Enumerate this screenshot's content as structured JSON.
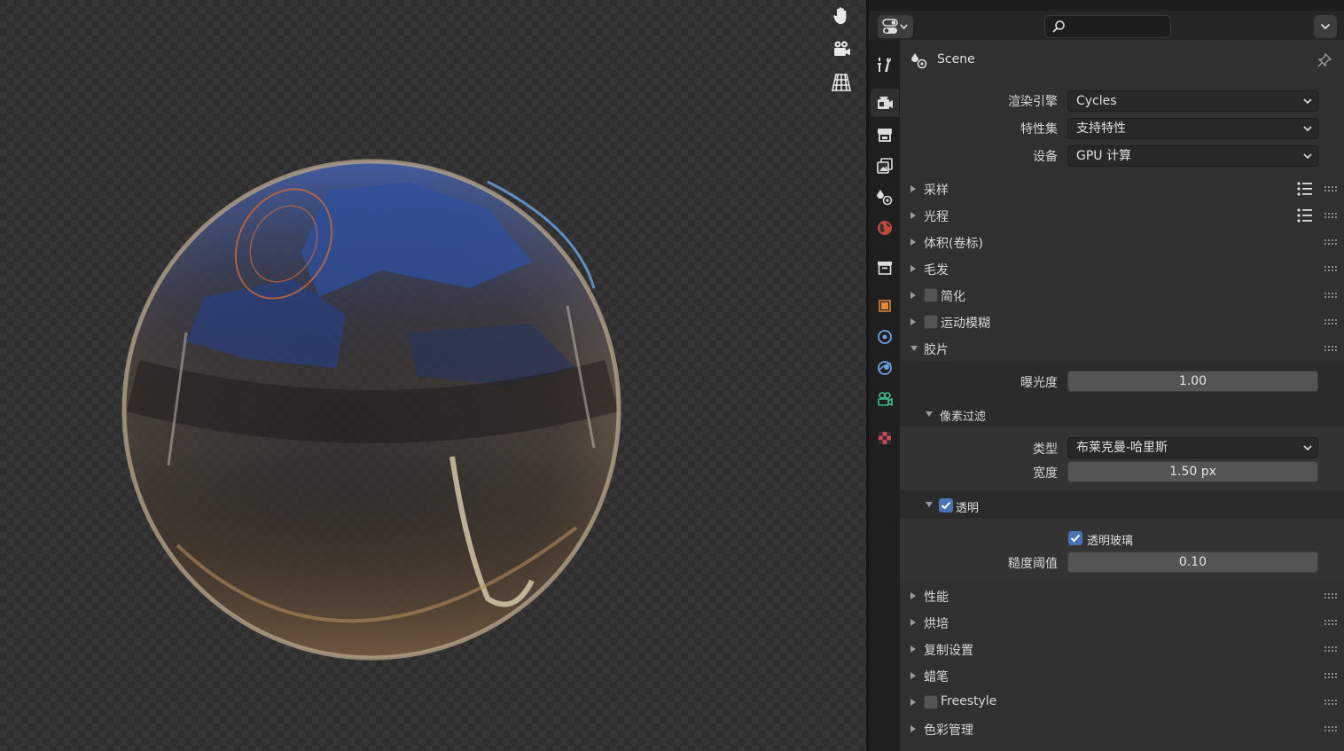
{
  "properties": {
    "context": {
      "title": "Scene"
    },
    "search": {
      "value": "",
      "placeholder": ""
    },
    "render": {
      "engine": {
        "label": "渲染引擎",
        "value": "Cycles"
      },
      "feature_set": {
        "label": "特性集",
        "value": "支持特性"
      },
      "device": {
        "label": "设备",
        "value": "GPU 计算"
      }
    },
    "panels": {
      "sampling": "采样",
      "light_paths": "光程",
      "volumes": "体积(卷标)",
      "hair": "毛发",
      "simplify": "简化",
      "motion_blur": "运动模糊",
      "film": "胶片",
      "performance": "性能",
      "bake": "烘培",
      "copy_settings": "复制设置",
      "grease_pencil": "蜡笔",
      "freestyle": "Freestyle",
      "color_management": "色彩管理"
    },
    "film": {
      "exposure": {
        "label": "曝光度",
        "value": "1.00"
      },
      "pixel_filter": {
        "title": "像素过滤",
        "type": {
          "label": "类型",
          "value": "布莱克曼-哈里斯"
        },
        "width": {
          "label": "宽度",
          "value": "1.50 px"
        }
      },
      "transparent": {
        "title": "透明",
        "checked": true,
        "glass": {
          "label": "透明玻璃",
          "checked": true
        },
        "roughness_threshold": {
          "label": "糙度阈值",
          "value": "0.10"
        }
      }
    }
  },
  "colors": {
    "accent_blue": "#4772b3",
    "panel_bg": "#303030",
    "header_bg": "#252525",
    "tab_strip_bg": "#1f1f1f"
  },
  "icons": {
    "viewport_tools": [
      "hand-icon",
      "camera-icon",
      "grid-icon"
    ],
    "tabs": [
      "tool-icon",
      "render-icon",
      "output-icon",
      "view-layer-icon",
      "scene-icon",
      "world-icon",
      "collection-icon",
      "object-icon",
      "modifier-icon",
      "particles-icon",
      "physics-icon",
      "constraints-icon",
      "texture-icon"
    ]
  }
}
